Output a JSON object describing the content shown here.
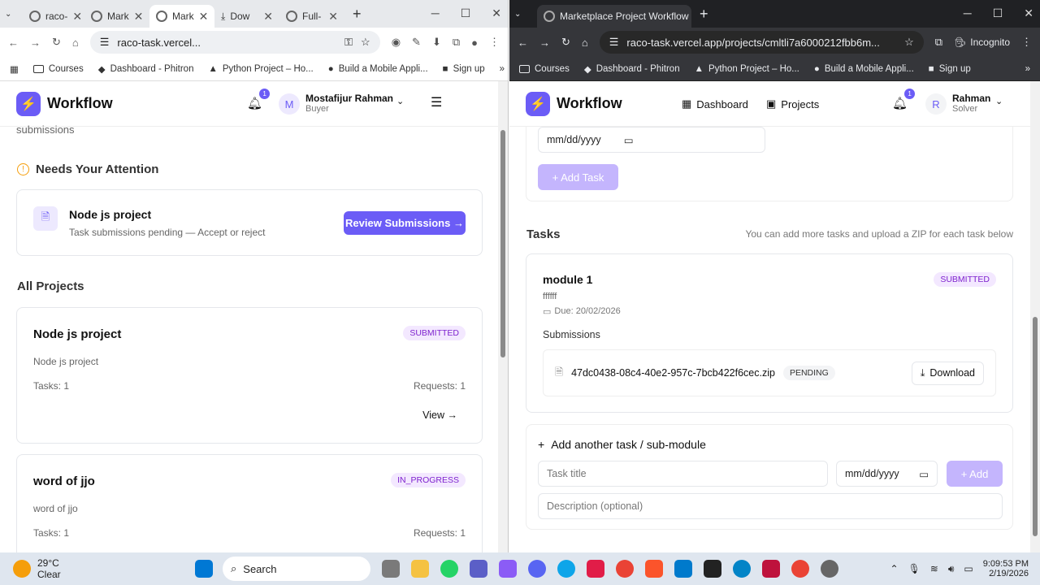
{
  "left": {
    "tabs": [
      "raco-",
      "Mark",
      "Mark",
      "Dow",
      "Full-"
    ],
    "url": "raco-task.vercel...",
    "bookmarks": [
      "Courses",
      "Dashboard - Phitron",
      "Python Project – Ho...",
      "Build a Mobile Appli...",
      "Sign up"
    ],
    "header": {
      "brand": "Workflow",
      "notif_count": "1",
      "avatar": "M",
      "name": "Mostafijur Rahman",
      "role": "Buyer"
    },
    "top_text": "submissions",
    "attention": {
      "heading": "Needs Your Attention",
      "title": "Node js project",
      "desc": "Task submissions pending — Accept or reject",
      "button": "Review Submissions →"
    },
    "all_projects": "All Projects",
    "projects": [
      {
        "title": "Node js project",
        "status": "SUBMITTED",
        "desc": "Node js project",
        "tasks": "Tasks: 1",
        "requests": "Requests: 1",
        "view": "View →"
      },
      {
        "title": "word of jjo",
        "status": "IN_PROGRESS",
        "desc": "word of jjo",
        "tasks": "Tasks: 1",
        "requests": "Requests: 1"
      }
    ]
  },
  "right": {
    "tab": "Marketplace Project Workflow",
    "url": "raco-task.vercel.app/projects/cmltli7a6000212fbb6m...",
    "incognito": "Incognito",
    "bookmarks": [
      "Courses",
      "Dashboard - Phitron",
      "Python Project – Ho...",
      "Build a Mobile Appli...",
      "Sign up"
    ],
    "header": {
      "brand": "Workflow",
      "nav": [
        "Dashboard",
        "Projects"
      ],
      "notif_count": "1",
      "avatar": "R",
      "name": "Rahman",
      "role": "Solver"
    },
    "date_placeholder": "mm/dd/yyyy",
    "add_task": "+ Add Task",
    "tasks_heading": "Tasks",
    "tasks_hint": "You can add more tasks and upload a ZIP for each task below",
    "task": {
      "title": "module 1",
      "status": "SUBMITTED",
      "desc": "ffffff",
      "due": "Due: 20/02/2026",
      "submissions_label": "Submissions",
      "file": "47dc0438-08c4-40e2-957c-7bcb422f6cec.zip",
      "file_status": "PENDING",
      "download": "Download"
    },
    "add_another": "Add another task / sub-module",
    "task_title_placeholder": "Task title",
    "date2": "mm/dd/yyyy",
    "add": "+ Add",
    "desc_placeholder": "Description (optional)"
  },
  "taskbar": {
    "temp": "29°C",
    "weather": "Clear",
    "search": "Search",
    "time": "9:09:53 PM",
    "date": "2/19/2026"
  }
}
